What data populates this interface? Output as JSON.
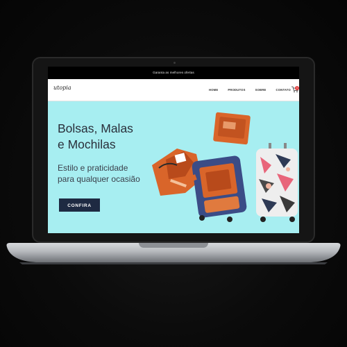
{
  "site": {
    "announcement": "Garanta as melhores ofertas",
    "logo": "utopia",
    "nav": [
      "HOME",
      "PRODUTOS",
      "SOBRE",
      "CONTATO"
    ],
    "cart_count": "0"
  },
  "hero": {
    "headline": [
      "Bolsas, Malas",
      "e Mochilas"
    ],
    "subheadline": [
      "Estilo e praticidade",
      "para qualquer ocasião"
    ],
    "cta_label": "CONFIRA",
    "colors": {
      "background": "#a7eef1",
      "cta": "#1e2a42",
      "bags": "#d9652a"
    }
  },
  "icons": [
    "cart-icon"
  ]
}
